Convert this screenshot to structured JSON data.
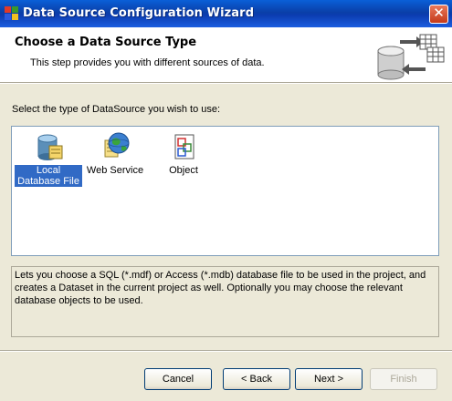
{
  "window": {
    "title": "Data Source Configuration Wizard",
    "close_glyph": "✕"
  },
  "header": {
    "title": "Choose a Data Source Type",
    "subtitle": "This step provides you with different sources of data.",
    "graphic_icon": "database-table-sync-icon"
  },
  "main": {
    "prompt": "Select the type of DataSource you wish to use:",
    "items": [
      {
        "label": "Local Database File",
        "icon": "database-icon",
        "selected": true
      },
      {
        "label": "Web Service",
        "icon": "web-service-globe-icon",
        "selected": false
      },
      {
        "label": "Object",
        "icon": "object-icon",
        "selected": false
      }
    ],
    "description": "Lets you choose a SQL (*.mdf) or Access (*.mdb) database file to be used in the project, and creates a Dataset in the current project as well.  Optionally you may choose the relevant database objects to be used."
  },
  "buttons": {
    "cancel": "Cancel",
    "back": "< Back",
    "next": "Next >",
    "finish": "Finish",
    "finish_enabled": false
  },
  "colors": {
    "titlebar": "#0a3fa8",
    "selection": "#316ac5",
    "dialog_bg": "#ece9d8"
  }
}
